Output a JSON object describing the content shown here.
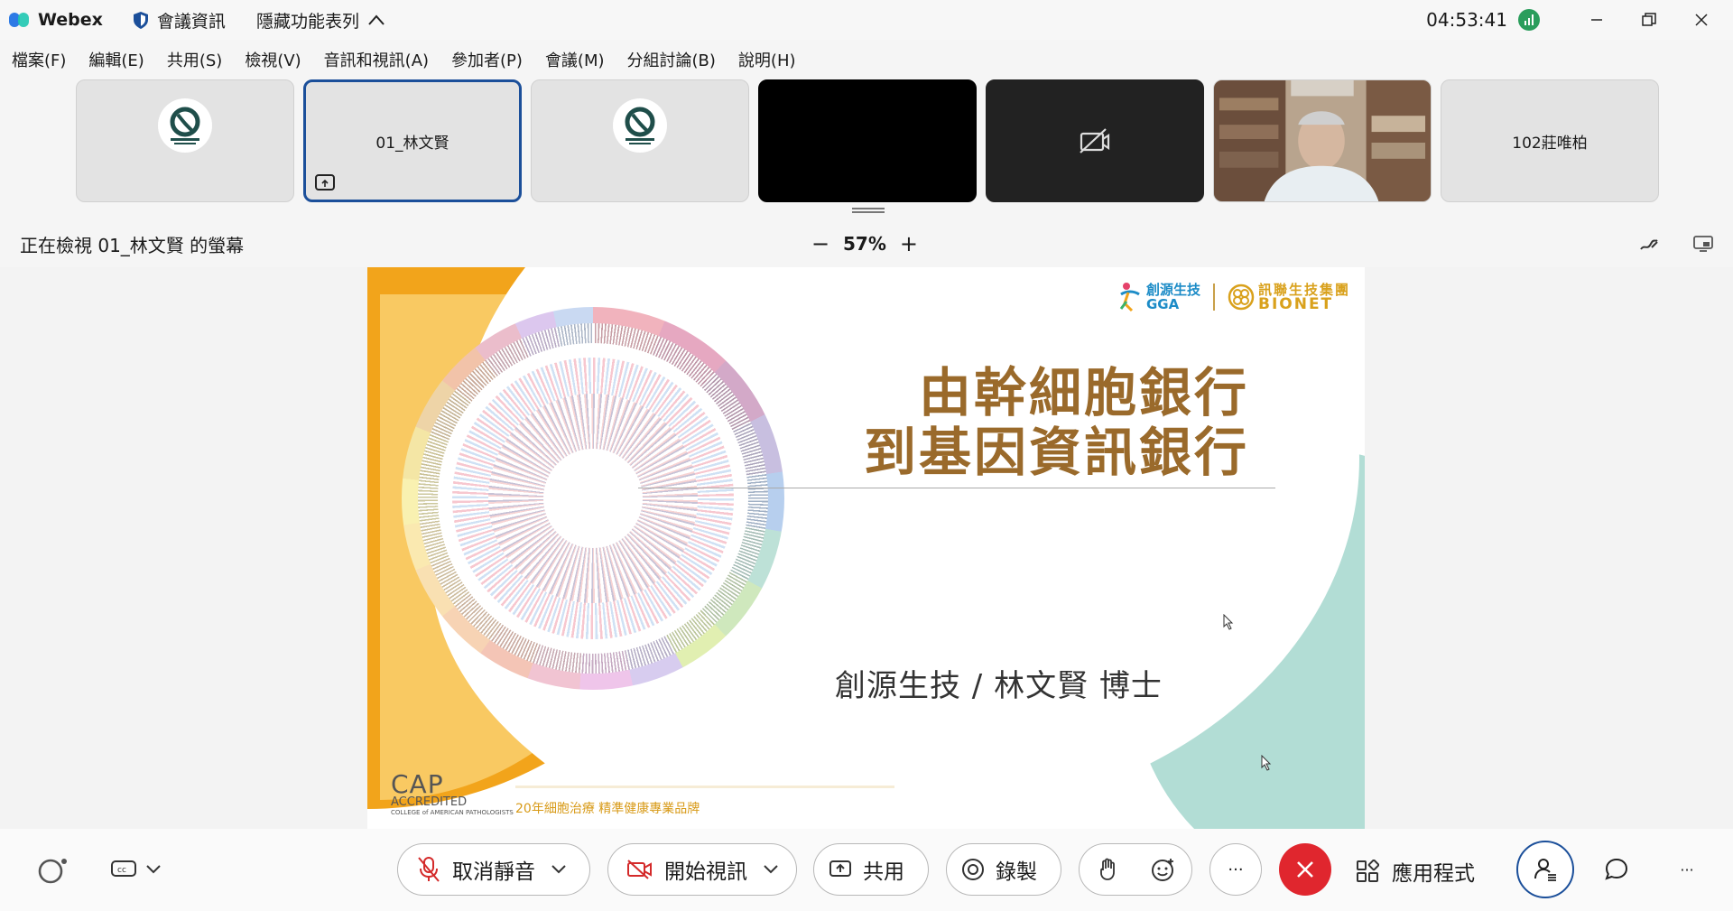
{
  "titlebar": {
    "app_name": "Webex",
    "meeting_info": "會議資訊",
    "hide_menu": "隱藏功能表列",
    "clock": "04:53:41"
  },
  "menu": [
    "檔案(F)",
    "編輯(E)",
    "共用(S)",
    "檢視(V)",
    "音訊和視訊(A)",
    "參加者(P)",
    "會議(M)",
    "分組討論(B)",
    "說明(H)"
  ],
  "participants": [
    {
      "name": ""
    },
    {
      "name": "01_林文賢"
    },
    {
      "name": ""
    },
    {
      "name": ""
    },
    {
      "name": ""
    },
    {
      "name": ""
    },
    {
      "name": "102莊唯柏"
    }
  ],
  "viewing": {
    "label": "正在檢視 01_林文賢 的螢幕",
    "zoom_out": "−",
    "zoom_level": "57%",
    "zoom_in": "+"
  },
  "slide": {
    "logo_gga_cn": "創源生技",
    "logo_gga_en": "GGA",
    "logo_bionet_cn": "訊聯生技集團",
    "logo_bionet_en": "BIONET",
    "title_line1": "由幹細胞銀行",
    "title_line2": "到基因資訊銀行",
    "presenter": "創源生技 / 林文賢 博士",
    "cap_big": "CAP",
    "cap_accredited": "ACCREDITED",
    "cap_college": "COLLEGE of AMERICAN PATHOLOGISTS",
    "tagline": "20年細胞治療  精準健康專業品牌"
  },
  "controls": {
    "unmute": "取消靜音",
    "start_video": "開始視訊",
    "share": "共用",
    "record": "錄製",
    "more": "···",
    "apps": "應用程式",
    "overflow": "···"
  },
  "colors": {
    "accent_blue": "#1b4f9a",
    "end_call": "#e0262e",
    "slide_title": "#9a6a2b",
    "orange": "#f2a41b",
    "teal": "#b2ddd5"
  }
}
